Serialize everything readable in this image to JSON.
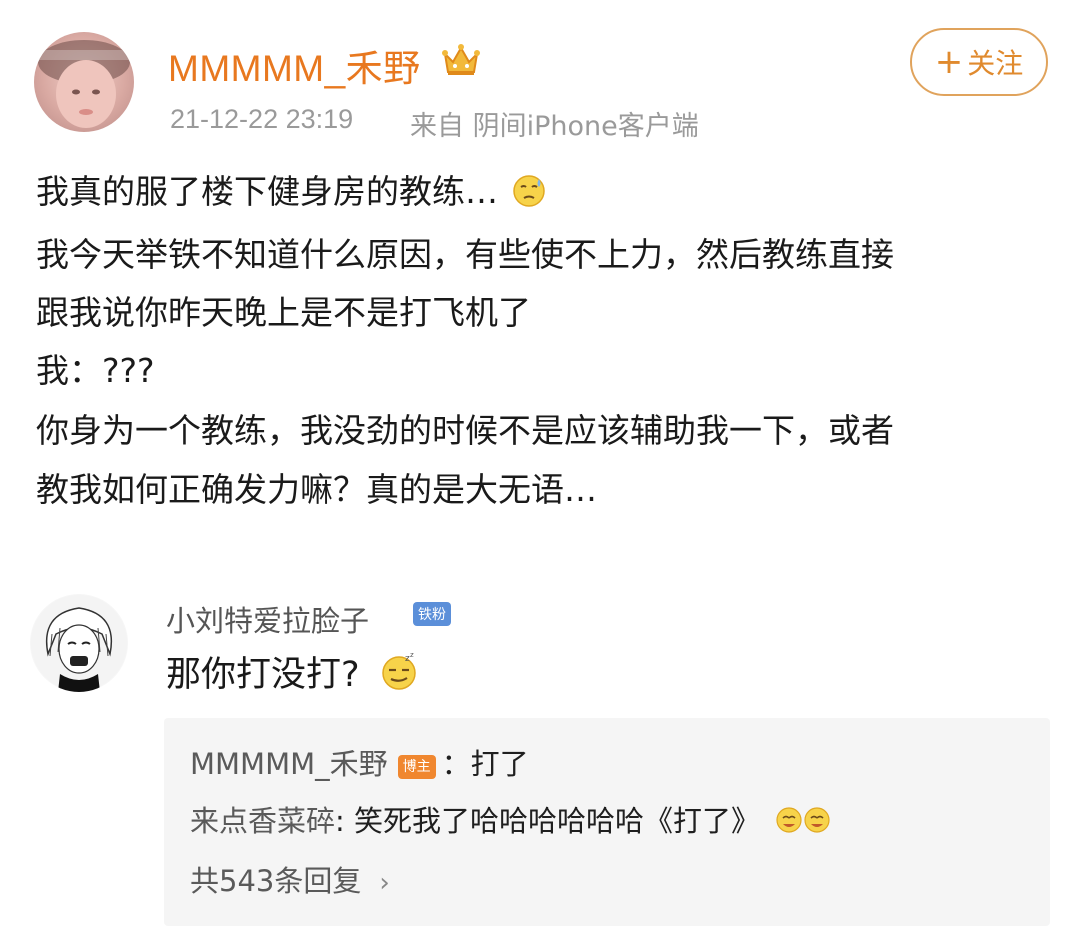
{
  "post": {
    "username": "MMMMM_禾野",
    "time": "21-12-22 23:19",
    "source": "来自 阴间iPhone客户端",
    "follow_label": "关注",
    "follow_plus": "+",
    "lines": [
      "我真的服了楼下健身房的教练…",
      "我今天举铁不知道什么原因，有些使不上力，然后教练直接",
      "跟我说你昨天晚上是不是打飞机了",
      "我：???",
      "你身为一个教练，我没劲的时候不是应该辅助我一下，或者",
      "教我如何正确发力嘛？真的是大无语…"
    ]
  },
  "comment": {
    "name": "小刘特爱拉脸子",
    "badge": "铁粉",
    "text": "那你打没打?",
    "replies": [
      {
        "name": "MMMMM_禾野",
        "badge": "博主",
        "text": "：打了"
      },
      {
        "name": "来点香菜碎",
        "text": ": 笑死我了哈哈哈哈哈哈《打了》"
      }
    ],
    "more_label": "共543条回复",
    "more_chevron": "›"
  },
  "colors": {
    "username": "#e8781f",
    "meta": "#9a9a9a",
    "follow_border": "#e0a35c",
    "author_badge": "#f0872f",
    "fan_badge": "#5b8fd9",
    "reply_bg": "#f5f5f5"
  },
  "icons": [
    "crown-icon",
    "sweat-emoji",
    "smirk-emoji",
    "laugh-hands-emoji",
    "chevron-right-icon"
  ]
}
